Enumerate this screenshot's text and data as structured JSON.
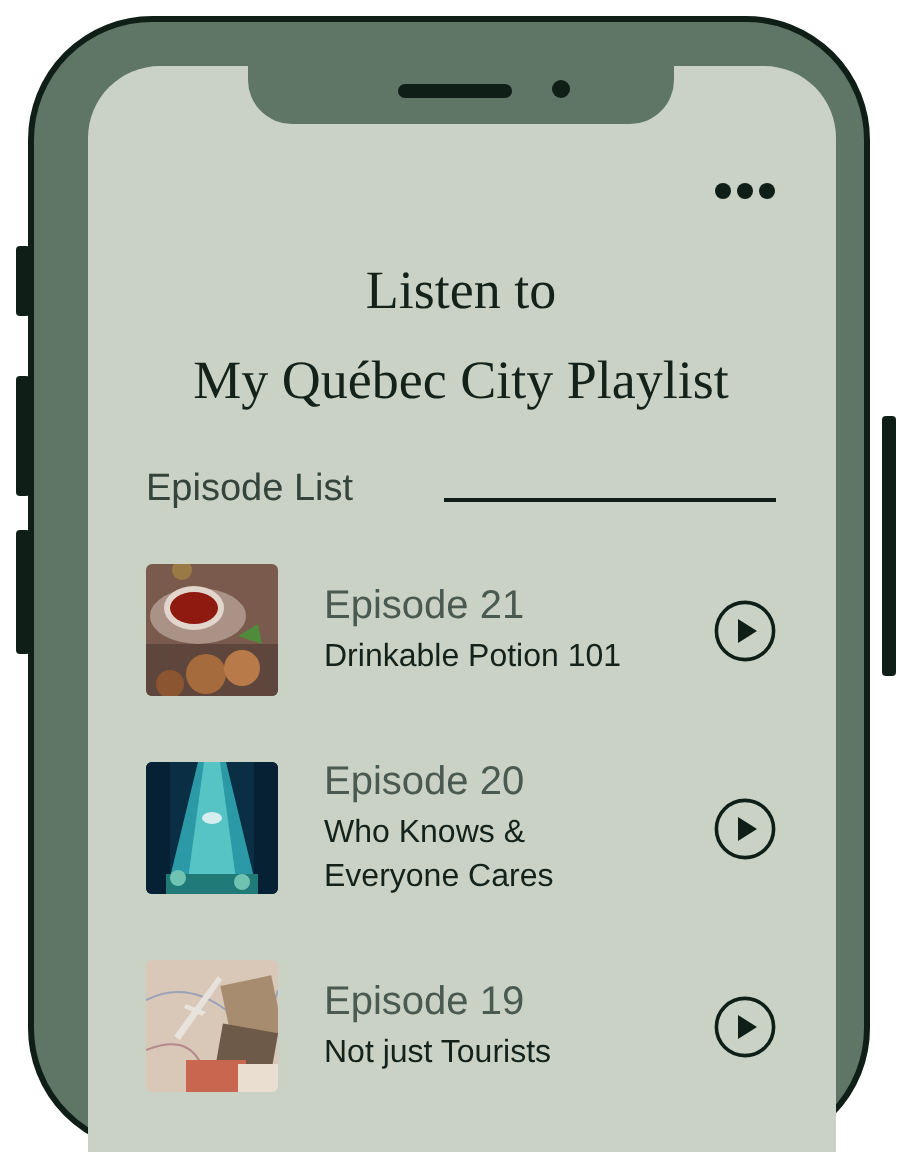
{
  "header": {
    "title_lines": [
      "Listen to",
      "My Québec City Playlist"
    ]
  },
  "section": {
    "label": "Episode List"
  },
  "episodes": [
    {
      "number": "Episode 21",
      "title": "Drinkable Potion 101"
    },
    {
      "number": "Episode 20",
      "title": "Who Knows & Everyone Cares"
    },
    {
      "number": "Episode 19",
      "title": "Not just Tourists"
    }
  ]
}
